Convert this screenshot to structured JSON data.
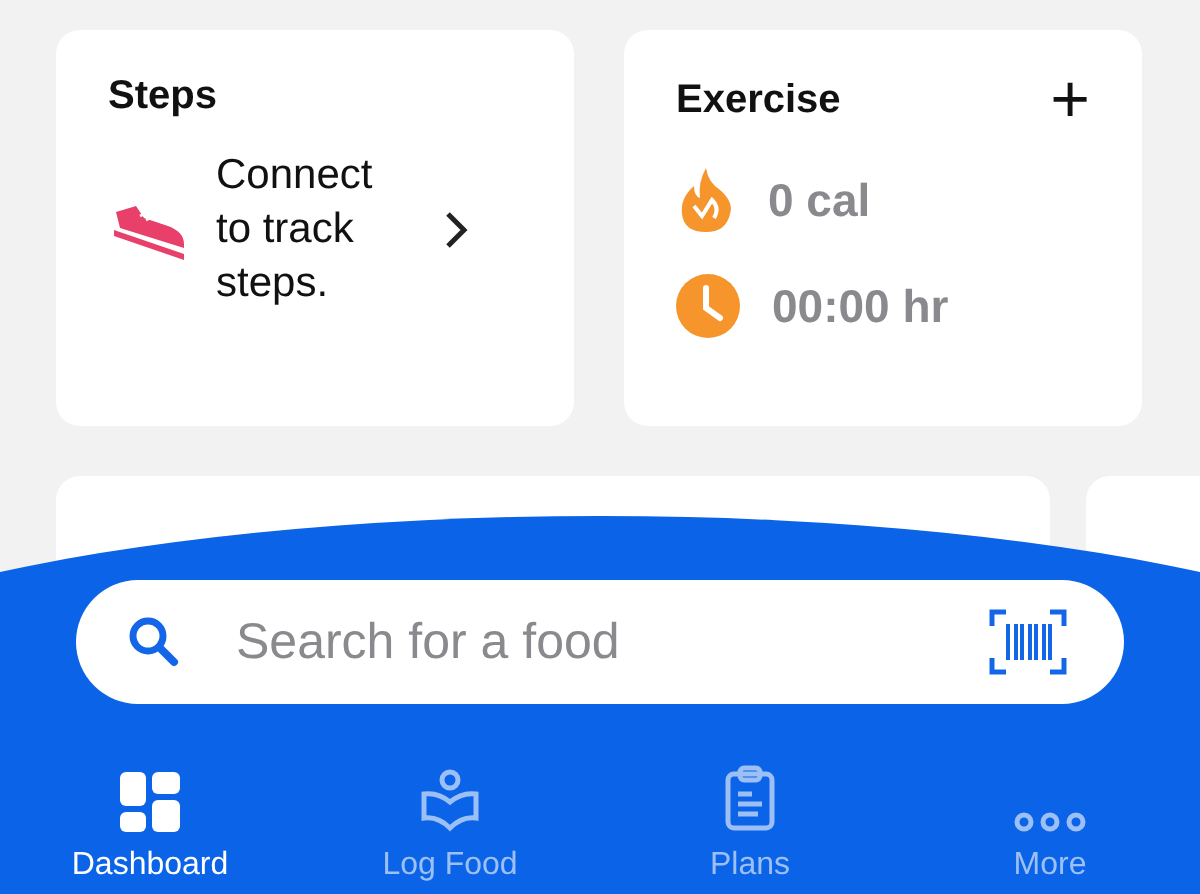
{
  "steps_card": {
    "title": "Steps",
    "message": "Connect to track steps."
  },
  "exercise_card": {
    "title": "Exercise",
    "add": "+",
    "stats": [
      {
        "kind": "calories",
        "value": "0 cal"
      },
      {
        "kind": "duration",
        "value": "00:00 hr"
      }
    ]
  },
  "search": {
    "placeholder": "Search for a food"
  },
  "tabs": [
    {
      "kind": "dashboard",
      "label": "Dashboard",
      "selected": true
    },
    {
      "kind": "log",
      "label": "Log Food",
      "selected": false
    },
    {
      "kind": "plans",
      "label": "Plans",
      "selected": false
    },
    {
      "kind": "more",
      "label": "More",
      "selected": false
    }
  ]
}
